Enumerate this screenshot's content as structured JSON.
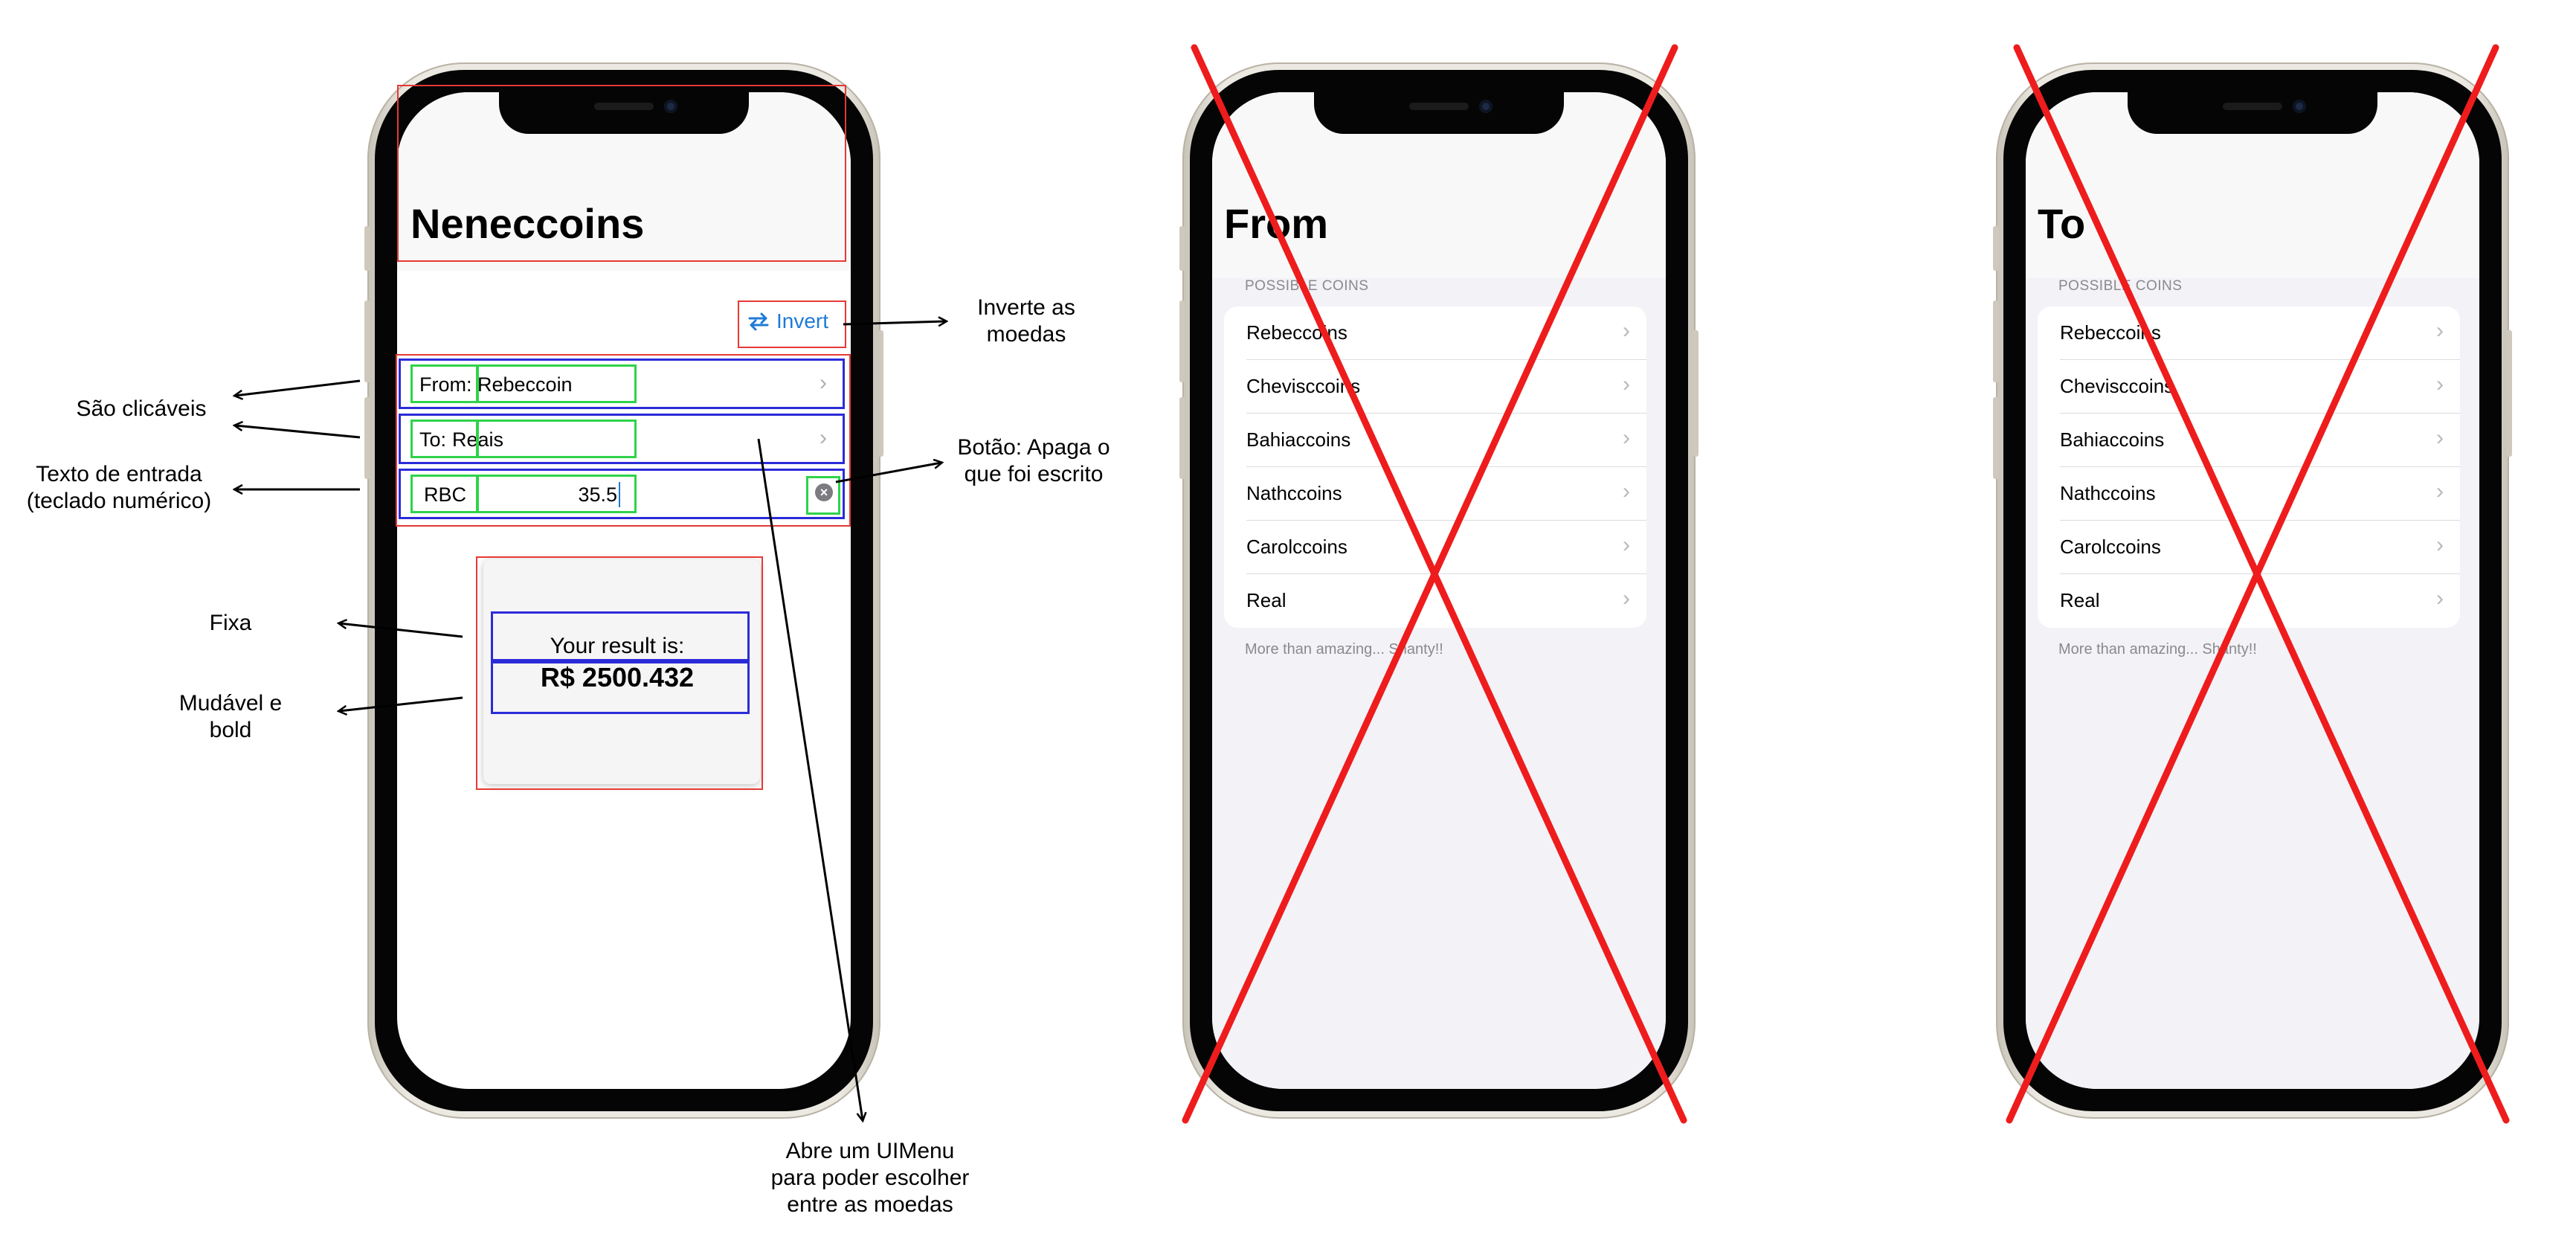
{
  "main_screen": {
    "title": "Neneccoins",
    "invert_label": "Invert",
    "from_label": "From:",
    "from_value": "Rebeccoin",
    "to_label": "To:",
    "to_value": "Reais",
    "amount_code": "RBC",
    "amount_value": "35.5",
    "result_caption": "Your result is:",
    "result_value": "R$ 2500.432"
  },
  "from_screen": {
    "title": "From",
    "section_header": "POSSIBLE COINS",
    "coins": [
      "Rebeccoins",
      "Chevisccoins",
      "Bahiaccoins",
      "Nathccoins",
      "Carolccoins",
      "Real"
    ],
    "footer": "More than amazing... Shanty!!"
  },
  "to_screen": {
    "title": "To",
    "section_header": "POSSIBLE COINS",
    "coins": [
      "Rebeccoins",
      "Chevisccoins",
      "Bahiaccoins",
      "Nathccoins",
      "Carolccoins",
      "Real"
    ],
    "footer": "More than amazing... Shanty!!"
  },
  "annotations": {
    "clickable": "São clicáveis",
    "input_text": "Texto de entrada\n(teclado numérico)",
    "fixed": "Fixa",
    "changeable": "Mudável e\nbold",
    "invert_note": "Inverte as\nmoedas",
    "clear_note": "Botão: Apaga o\nque foi escrito",
    "menu_note": "Abre um UIMenu\npara poder escolher\nentre as moedas"
  },
  "icons": [
    "swap-arrows-icon",
    "chevron-right-icon",
    "clear-circle-icon",
    "arrow-icon",
    "cross-out-icon"
  ],
  "colors": {
    "accent": "#1e7ad6",
    "annotation_red": "#e53935",
    "annotation_blue": "#2b2bd9",
    "annotation_green": "#2fd34a"
  }
}
